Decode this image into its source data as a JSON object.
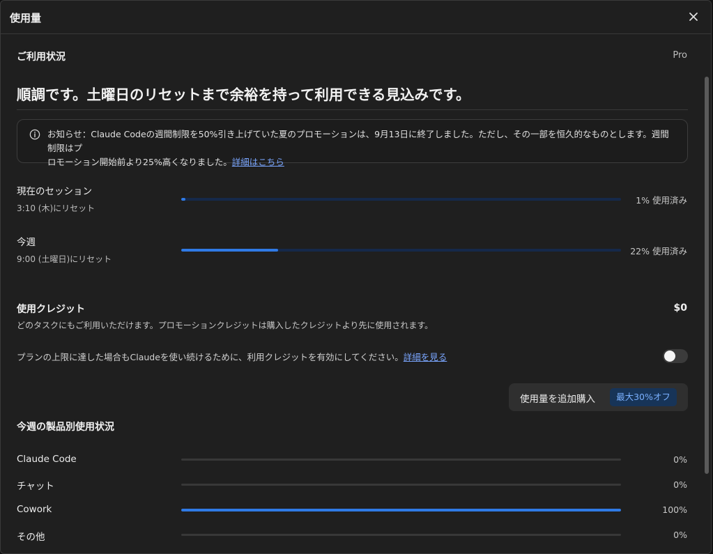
{
  "header": {
    "title": "使用量",
    "close_icon": "close-icon"
  },
  "status": {
    "section_title": "ご利用状況",
    "plan": "Pro",
    "headline": "順調です。土曜日のリセットまで余裕を持って利用できる見込みです。"
  },
  "notice": {
    "icon": "info-icon",
    "text_line1": "お知らせ：Claude Codeの週間制限を50%引き上げていた夏のプロモーションは、9月13日に終了しました。ただし、その一部を恒久的なものとします。週間制限はプ",
    "text_line2": "ロモーション開始前より25%高くなりました。",
    "link": "詳細はこちら"
  },
  "limits": [
    {
      "label": "現在のセッション",
      "reset": "3:10 (木)にリセット",
      "percent": 1,
      "percent_text": "1% 使用済み"
    },
    {
      "label": "今週",
      "reset": "9:00 (土曜日)にリセット",
      "percent": 22,
      "percent_text": "22% 使用済み"
    }
  ],
  "credits": {
    "title": "使用クレジット",
    "amount": "$0",
    "description": "どのタスクにもご利用いただけます。プロモーションクレジットは購入したクレジットより先に使用されます。",
    "toggle_text": "プランの上限に達した場合もClaudeを使い続けるために、利用クレジットを有効にしてください。",
    "toggle_link": "詳細を見る",
    "toggle_on": false,
    "buy_label": "使用量を追加購入",
    "discount": "最大30%オフ"
  },
  "products": {
    "title": "今週の製品別使用状況",
    "items": [
      {
        "name": "Claude Code",
        "percent": 0,
        "percent_text": "0%"
      },
      {
        "name": "チャット",
        "percent": 0,
        "percent_text": "0%"
      },
      {
        "name": "Cowork",
        "percent": 100,
        "percent_text": "100%"
      },
      {
        "name": "その他",
        "percent": 0,
        "percent_text": "0%"
      }
    ]
  },
  "colors": {
    "accent": "#2f7ae5",
    "link": "#7aa6ff",
    "background": "#1f1f1f"
  }
}
